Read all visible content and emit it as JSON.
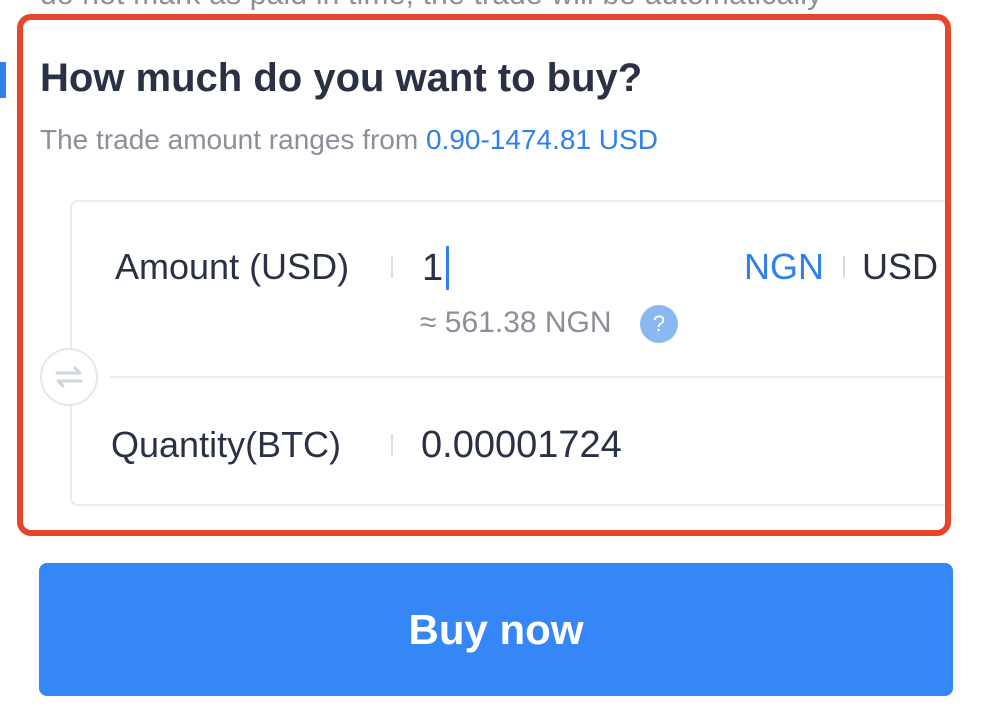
{
  "notice": {
    "text": "do not mark as paid in time, the trade will be automatically"
  },
  "buy_form": {
    "heading": "How much do you want to buy?",
    "range_prefix": "The trade amount ranges from ",
    "range_value": "0.90-1474.81 USD",
    "amount": {
      "label": "Amount (USD)",
      "value": "1",
      "approx": "≈ 561.38 NGN",
      "help": "?",
      "currency_options": [
        "NGN",
        "USD"
      ],
      "selected_currency": "USD"
    },
    "quantity": {
      "label": "Quantity(BTC)",
      "value": "0.00001724"
    }
  },
  "actions": {
    "buy_label": "Buy now"
  },
  "colors": {
    "accent": "#2f80ed",
    "button": "#3586f6",
    "highlight_border": "#e8442c",
    "text_dark": "#2b3144",
    "text_muted": "#8a8f99"
  },
  "icons": [
    "help-icon",
    "swap-icon"
  ]
}
